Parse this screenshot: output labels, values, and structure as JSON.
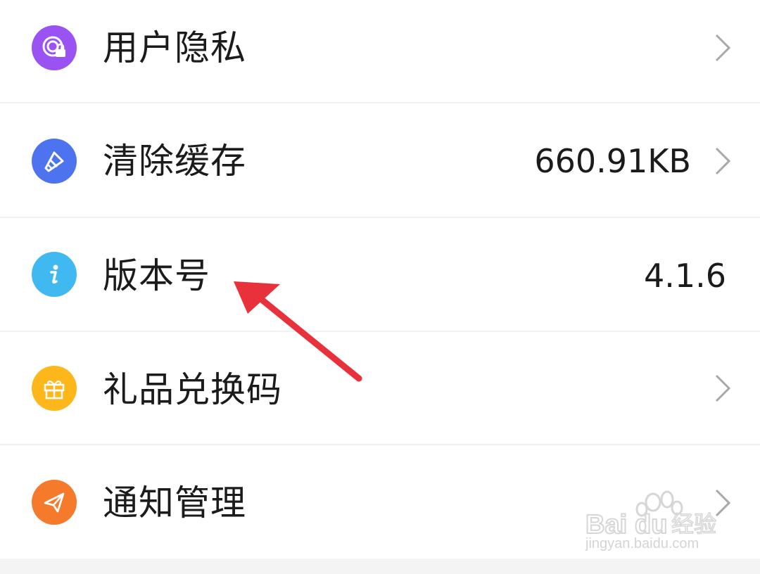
{
  "settings": {
    "items": [
      {
        "label": "用户隐私",
        "value": "",
        "icon": "privacy-lock-icon",
        "icon_color": "#9b52f3",
        "has_chevron": true
      },
      {
        "label": "清除缓存",
        "value": "660.91KB",
        "icon": "broom-icon",
        "icon_color": "#4d74ee",
        "has_chevron": true
      },
      {
        "label": "版本号",
        "value": "4.1.6",
        "icon": "info-icon",
        "icon_color": "#40b8f0",
        "has_chevron": false
      },
      {
        "label": "礼品兑换码",
        "value": "",
        "icon": "gift-icon",
        "icon_color": "#fdb71a",
        "has_chevron": true
      },
      {
        "label": "通知管理",
        "value": "",
        "icon": "paper-plane-icon",
        "icon_color": "#f57a2b",
        "has_chevron": true
      }
    ]
  },
  "annotation": {
    "arrow_color": "#e8313a"
  },
  "watermark": {
    "brand": "Baidu经验",
    "url": "jingyan.baidu.com"
  }
}
